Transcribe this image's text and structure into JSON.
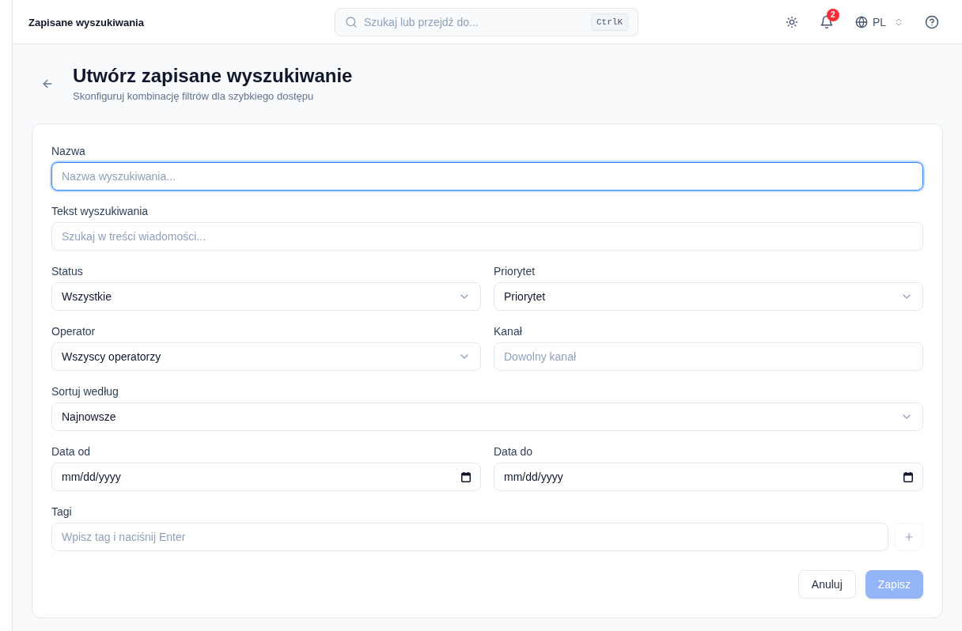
{
  "header": {
    "title": "Zapisane wyszukiwania",
    "search": {
      "placeholder": "Szukaj lub przejdź do...",
      "shortcut": "CtrlK"
    },
    "notifications_count": "2",
    "language": "PL"
  },
  "page": {
    "title": "Utwórz zapisane wyszukiwanie",
    "subtitle": "Skonfiguruj kombinację filtrów dla szybkiego dostępu"
  },
  "form": {
    "rows": [
      [
        {
          "kind": "text",
          "label": "Nazwa",
          "placeholder": "Nazwa wyszukiwania...",
          "focused": true
        }
      ],
      [
        {
          "kind": "text",
          "label": "Tekst wyszukiwania",
          "placeholder": "Szukaj w treści wiadomości...",
          "focused": false
        }
      ],
      [
        {
          "kind": "select",
          "label": "Status",
          "value": "Wszystkie",
          "focused": false
        },
        {
          "kind": "select",
          "label": "Priorytet",
          "value": "Priorytet",
          "focused": false
        }
      ],
      [
        {
          "kind": "select",
          "label": "Operator",
          "value": "Wszyscy operatorzy",
          "focused": false
        },
        {
          "kind": "text",
          "label": "Kanał",
          "placeholder": "Dowolny kanał",
          "focused": false
        }
      ],
      [
        {
          "kind": "select",
          "label": "Sortuj według",
          "value": "Najnowsze",
          "focused": false
        }
      ],
      [
        {
          "kind": "date",
          "label": "Data od",
          "value": "mm/dd/yyyy",
          "focused": false
        },
        {
          "kind": "date",
          "label": "Data do",
          "value": "mm/dd/yyyy",
          "focused": false
        }
      ],
      [
        {
          "kind": "tags",
          "label": "Tagi",
          "placeholder": "Wpisz tag i naciśnij Enter",
          "focused": false
        }
      ]
    ],
    "buttons": [
      {
        "kind": "secondary",
        "label": "Anuluj",
        "disabled": false
      },
      {
        "kind": "primary",
        "label": "Zapisz",
        "disabled": true
      }
    ]
  }
}
